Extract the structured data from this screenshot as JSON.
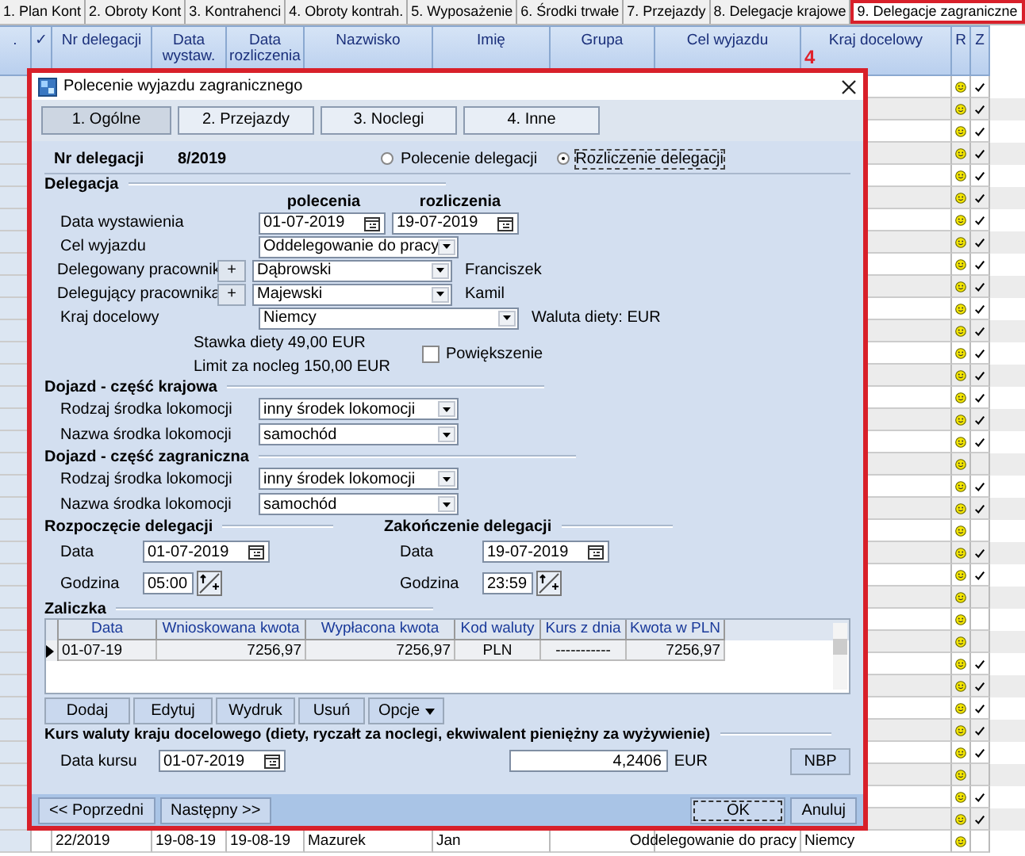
{
  "top_tabs": [
    {
      "label": "1. Plan Kont",
      "selected": false
    },
    {
      "label": "2. Obroty Kont",
      "selected": false
    },
    {
      "label": "3. Kontrahenci",
      "selected": false
    },
    {
      "label": "4. Obroty kontrah.",
      "selected": false
    },
    {
      "label": "5. Wyposażenie",
      "selected": false
    },
    {
      "label": "6. Środki trwałe",
      "selected": false
    },
    {
      "label": "7. Przejazdy",
      "selected": false
    },
    {
      "label": "8. Delegacje krajowe",
      "selected": false
    },
    {
      "label": "9. Delegacje zagraniczne",
      "selected": true
    }
  ],
  "grid": {
    "columns": [
      ".",
      "✓",
      "Nr delegacji",
      "Data wystaw.",
      "Data rozliczenia",
      "Nazwisko",
      "Imię",
      "Grupa",
      "Cel wyjazdu",
      "Kraj docelowy",
      "R",
      "Z"
    ],
    "annotation": "4",
    "rows": [
      {
        "checked": true
      },
      {
        "checked": true
      },
      {
        "checked": true
      },
      {
        "checked": true
      },
      {
        "checked": true
      },
      {
        "checked": true
      },
      {
        "checked": true
      },
      {
        "checked": true
      },
      {
        "checked": true
      },
      {
        "checked": true
      },
      {
        "checked": true
      },
      {
        "checked": true
      },
      {
        "checked": true
      },
      {
        "checked": true
      },
      {
        "checked": true
      },
      {
        "checked": true
      },
      {
        "checked": true
      },
      {
        "checked": false
      },
      {
        "checked": true
      },
      {
        "checked": true
      },
      {
        "checked": false
      },
      {
        "checked": true
      },
      {
        "checked": true
      },
      {
        "checked": false
      },
      {
        "checked": false
      },
      {
        "checked": false
      },
      {
        "checked": true
      },
      {
        "checked": true
      },
      {
        "checked": true
      },
      {
        "checked": true
      },
      {
        "checked": true
      },
      {
        "checked": false
      },
      {
        "checked": true
      },
      {
        "checked": true
      },
      {
        "checked": false,
        "nr_delegacji": "22/2019",
        "data_wystaw": "19-08-19",
        "data_rozliczenia": "19-08-19",
        "nazwisko": "Mazurek",
        "imie": "Jan",
        "cel_wyjazdu": "Oddelegowanie do pracy",
        "kraj_docelowy": "Niemcy"
      }
    ]
  },
  "dialog": {
    "title": "Polecenie wyjazdu zagranicznego",
    "tabs": [
      {
        "label": "1. Ogólne",
        "selected": true
      },
      {
        "label": "2. Przejazdy",
        "selected": false
      },
      {
        "label": "3. Noclegi",
        "selected": false
      },
      {
        "label": "4. Inne",
        "selected": false
      }
    ],
    "nr_label": "Nr delegacji",
    "nr_value": "8/2019",
    "mode_options": [
      {
        "label": "Polecenie delegacji",
        "selected": false
      },
      {
        "label": "Rozliczenie delegacji",
        "selected": true
      }
    ],
    "delegacja": {
      "title": "Delegacja",
      "col_headers": [
        "polecenia",
        "rozliczenia"
      ],
      "data_wystawienia": {
        "label": "Data wystawienia",
        "values": [
          "01-07-2019",
          "19-07-2019"
        ]
      },
      "cel": {
        "label": "Cel wyjazdu",
        "value": "Oddelegowanie do pracy"
      },
      "delegowany": {
        "label": "Delegowany pracownik",
        "plus": "+",
        "value": "Dąbrowski",
        "extra": "Franciszek"
      },
      "delegujacy": {
        "label": "Delegujący pracownika",
        "plus": "+",
        "value": "Majewski",
        "extra": "Kamil"
      },
      "kraj": {
        "label": "Kraj docelowy",
        "value": "Niemcy",
        "extra": "Waluta diety: EUR"
      },
      "stawka": "Stawka diety 49,00 EUR",
      "limit": "Limit za nocleg  150,00 EUR",
      "powiekszenie": {
        "label": "Powiększenie",
        "checked": false
      }
    },
    "dojazd": [
      {
        "title": "Dojazd - część krajowa",
        "rows": [
          {
            "label": "Rodzaj środka lokomocji",
            "value": "inny środek lokomocji"
          },
          {
            "label": "Nazwa środka lokomocji",
            "value": "samochód"
          }
        ]
      },
      {
        "title": "Dojazd - część zagraniczna",
        "rows": [
          {
            "label": "Rodzaj środka lokomocji",
            "value": "inny środek lokomocji"
          },
          {
            "label": "Nazwa środka lokomocji",
            "value": "samochód"
          }
        ]
      }
    ],
    "periods": [
      {
        "title": "Rozpoczęcie delegacji",
        "date_label": "Data",
        "date": "01-07-2019",
        "time_label": "Godzina",
        "time": "05:00"
      },
      {
        "title": "Zakończenie delegacji",
        "date_label": "Data",
        "date": "19-07-2019",
        "time_label": "Godzina",
        "time": "23:59"
      }
    ],
    "zaliczka": {
      "title": "Zaliczka",
      "columns": [
        "Data",
        "Wnioskowana kwota",
        "Wypłacona kwota",
        "Kod waluty",
        "Kurs z dnia",
        "Kwota w PLN"
      ],
      "rows": [
        {
          "selected": true,
          "cells": [
            "01-07-19",
            "7256,97",
            "7256,97",
            "PLN",
            "-----------",
            "7256,97"
          ]
        }
      ],
      "buttons": [
        {
          "label": "Dodaj",
          "menu": false
        },
        {
          "label": "Edytuj",
          "menu": false
        },
        {
          "label": "Wydruk",
          "menu": false
        },
        {
          "label": "Usuń",
          "menu": false
        },
        {
          "label": "Opcje",
          "menu": true
        }
      ]
    },
    "kurs": {
      "title": "Kurs waluty kraju docelowego (diety, ryczałt za noclegi, ekwiwalent pieniężny za wyżywienie)",
      "date_label": "Data kursu",
      "date": "01-07-2019",
      "rate": "4,2406",
      "currency": "EUR",
      "nbp": "NBP"
    },
    "footer": {
      "prev": "<< Poprzedni",
      "next": "Następny >>",
      "ok": "OK",
      "cancel": "Anuluj"
    }
  }
}
